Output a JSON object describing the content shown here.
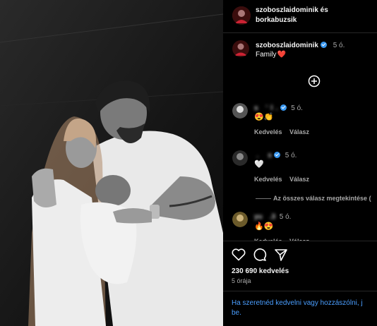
{
  "header": {
    "title_line1": "szoboszlaidominik és",
    "title_line2": "borkabuzsik"
  },
  "post": {
    "author": "szoboszlaidominik",
    "time": "5 ó.",
    "caption": "Family",
    "caption_emoji": "❤️"
  },
  "comments": [
    {
      "username": "s      '  l  .",
      "time": "5 ó.",
      "emoji": "😍👏",
      "like_label": "Kedvelés",
      "reply_label": "Válasz"
    },
    {
      "username": "  .        s",
      "time": "5 ó.",
      "emoji": "🤍",
      "like_label": "Kedvelés",
      "reply_label": "Válasz"
    },
    {
      "username": "yu      .3",
      "time": "5 ó.",
      "emoji": "🔥😍",
      "like_label": "Kedvelés",
      "reply_label": "Válasz"
    }
  ],
  "view_replies": "Az összes válasz megtekintése (",
  "actions": {
    "likes": "230 690 kedvelés",
    "age": "5 órája"
  },
  "login_prompt": {
    "text": "Ha szeretnéd kedvelni vagy hozzászólni, j",
    "link": "be."
  },
  "icons": {
    "add": "plus-circle-icon",
    "like": "heart-outline-icon",
    "comment": "comment-bubble-icon",
    "share": "paper-plane-icon"
  },
  "colors": {
    "background": "#000000",
    "verified": "#3897f0",
    "link": "#4a9eff",
    "heart": "#ed4956"
  }
}
